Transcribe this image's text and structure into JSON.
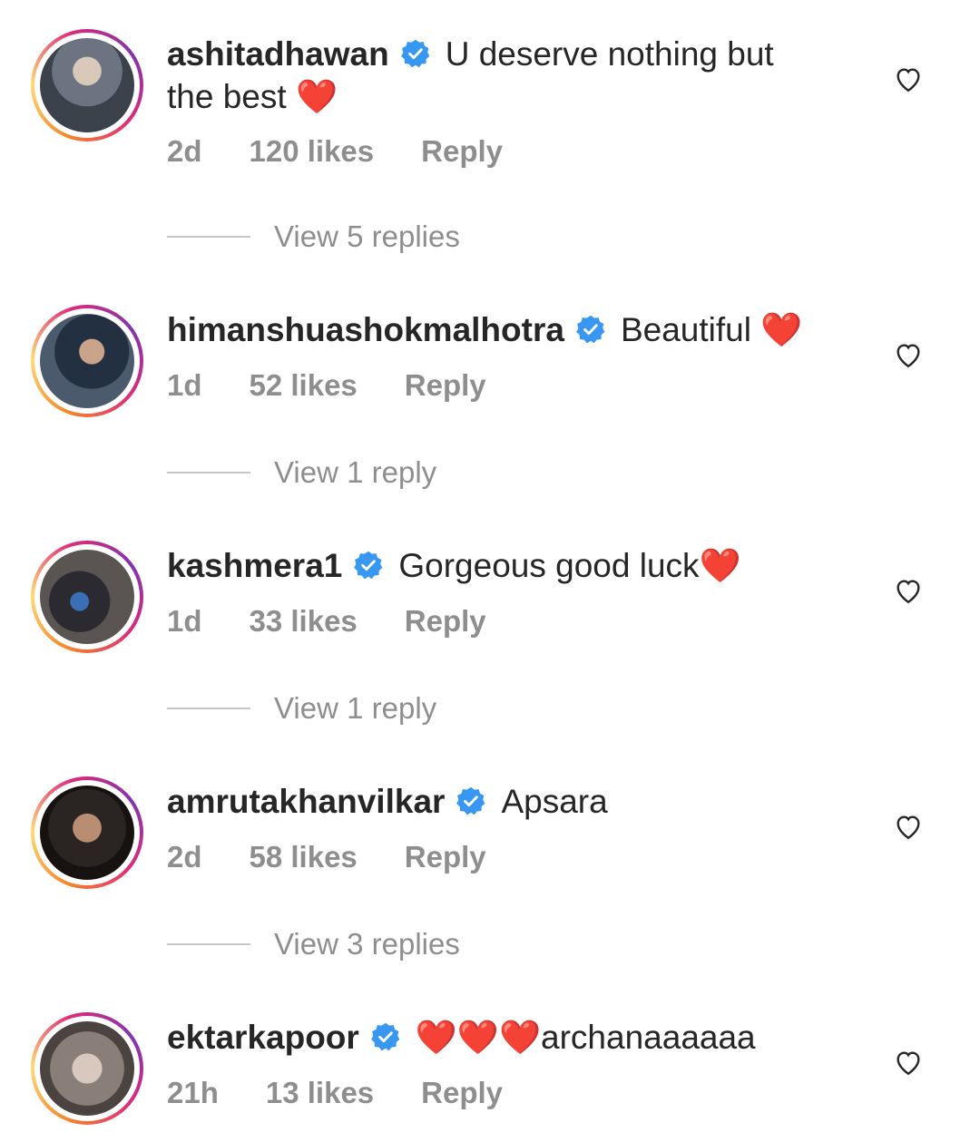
{
  "comments": [
    {
      "username": "ashitadhawan",
      "text_line1": "U deserve nothing but",
      "text_line2": "the best ",
      "emoji": "❤️",
      "time": "2d",
      "likes": "120 likes",
      "reply": "Reply",
      "view_replies": "View 5 replies",
      "avatar_color": "#5b6470"
    },
    {
      "username": "himanshuashokmalhotra",
      "text": "Beautiful ",
      "emoji": "❤️",
      "time": "1d",
      "likes": "52 likes",
      "reply": "Reply",
      "view_replies": "View 1 reply",
      "avatar_color": "#2f3a48"
    },
    {
      "username": "kashmera1",
      "text": "Gorgeous good luck",
      "emoji": "❤️",
      "time": "1d",
      "likes": "33 likes",
      "reply": "Reply",
      "view_replies": "View 1 reply",
      "avatar_color": "#3d3d44"
    },
    {
      "username": "amrutakhanvilkar",
      "text": "Apsara",
      "time": "2d",
      "likes": "58 likes",
      "reply": "Reply",
      "view_replies": "View 3 replies",
      "avatar_color": "#2a2522"
    },
    {
      "username": "ektarkapoor",
      "emoji": "❤️❤️❤️",
      "text": "archanaaaaaa",
      "time": "21h",
      "likes": "13 likes",
      "reply": "Reply",
      "avatar_color": "#8a7f78"
    }
  ],
  "colors": {
    "verified": "#3897f0",
    "meta": "#8e8e8e",
    "heart": "#e0152b"
  },
  "icons": {
    "verified": "verified-badge-icon",
    "like": "heart-outline-icon"
  }
}
